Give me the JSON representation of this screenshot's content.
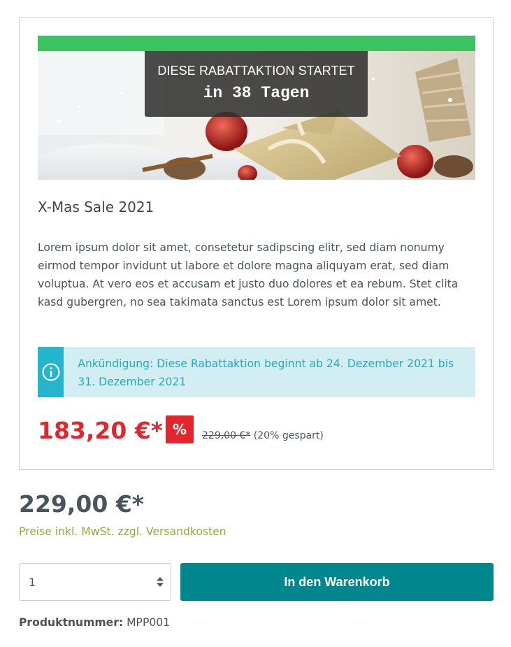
{
  "campaign": {
    "countdown_heading": "DIESE RABATTAKTION STARTET",
    "countdown_time": "in 38 Tagen",
    "title": "X-Mas Sale 2021",
    "description": "Lorem ipsum dolor sit amet, consetetur sadipscing elitr, sed diam nonumy eirmod tempor invidunt ut labore et dolore magna aliquyam erat, sed diam voluptua. At vero eos et accusam et justo duo dolores et ea rebum. Stet clita kasd gubergren, no sea takimata sanctus est Lorem ipsum dolor sit amet.",
    "announcement": "Ankündigung: Diese Rabattaktion beginnt ab 24. Dezember 2021 bis 31. Dezember 2021",
    "announcement_icon": "info-icon",
    "sale_price": "183,20 €*",
    "percent_badge": "%",
    "old_price": "229,00 €*",
    "savings": "(20% gespart)",
    "colors": {
      "progress_bar": "#3cc261",
      "sale_red": "#e3262d",
      "info_blue": "#25b5cc",
      "info_bg": "#d3eef2"
    }
  },
  "product": {
    "price": "229,00 €*",
    "tax_note": "Preise inkl. MwSt. zzgl. Versandkosten",
    "quantity": "1",
    "add_to_cart_label": "In den Warenkorb",
    "product_number_label": "Produktnummer:",
    "product_number": "MPP001",
    "colors": {
      "button": "#00868d",
      "tax_note": "#89b03a"
    }
  }
}
